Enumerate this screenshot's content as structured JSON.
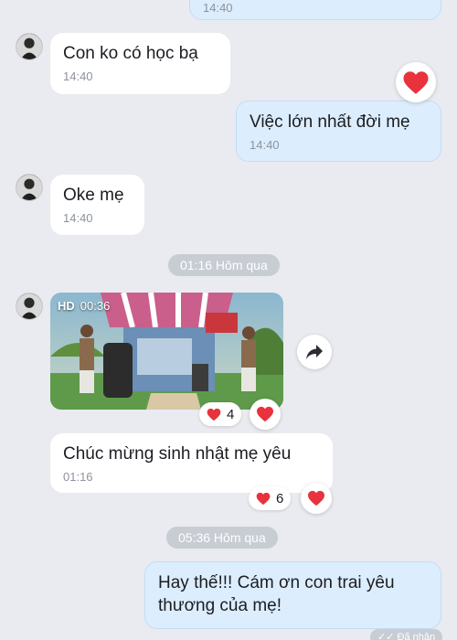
{
  "messages": [
    {
      "id": "m0",
      "direction": "out",
      "text": "",
      "time": "14:40"
    },
    {
      "id": "m1",
      "direction": "in",
      "text": "Con ko có học bạ",
      "time": "14:40"
    },
    {
      "id": "m2",
      "direction": "out",
      "text": "Việc lớn nhất đời mẹ",
      "time": "14:40",
      "reaction": "heart-icon"
    },
    {
      "id": "m3",
      "direction": "in",
      "text": "Oke mẹ",
      "time": "14:40"
    },
    {
      "id": "m4",
      "direction": "in",
      "type": "video",
      "badge": "HD",
      "duration": "00:36",
      "reaction_count": "4",
      "reaction": "heart-icon"
    },
    {
      "id": "m5",
      "direction": "in",
      "text": "Chúc mừng sinh nhật mẹ yêu",
      "time": "01:16",
      "reaction_count": "6",
      "reaction": "heart-icon"
    },
    {
      "id": "m6",
      "direction": "out",
      "text": "Hay thế!!! Cám ơn con trai yêu thương của mẹ!"
    }
  ],
  "date_separators": [
    "01:16 Hôm qua",
    "05:36 Hôm qua"
  ],
  "status": {
    "seen_label": "Đã nhận"
  },
  "colors": {
    "background": "#e9ebf0",
    "incoming_bubble": "#ffffff",
    "outgoing_bubble": "#dcedfd",
    "heart": "#e8323c",
    "date_pill": "#c8ccd3"
  }
}
